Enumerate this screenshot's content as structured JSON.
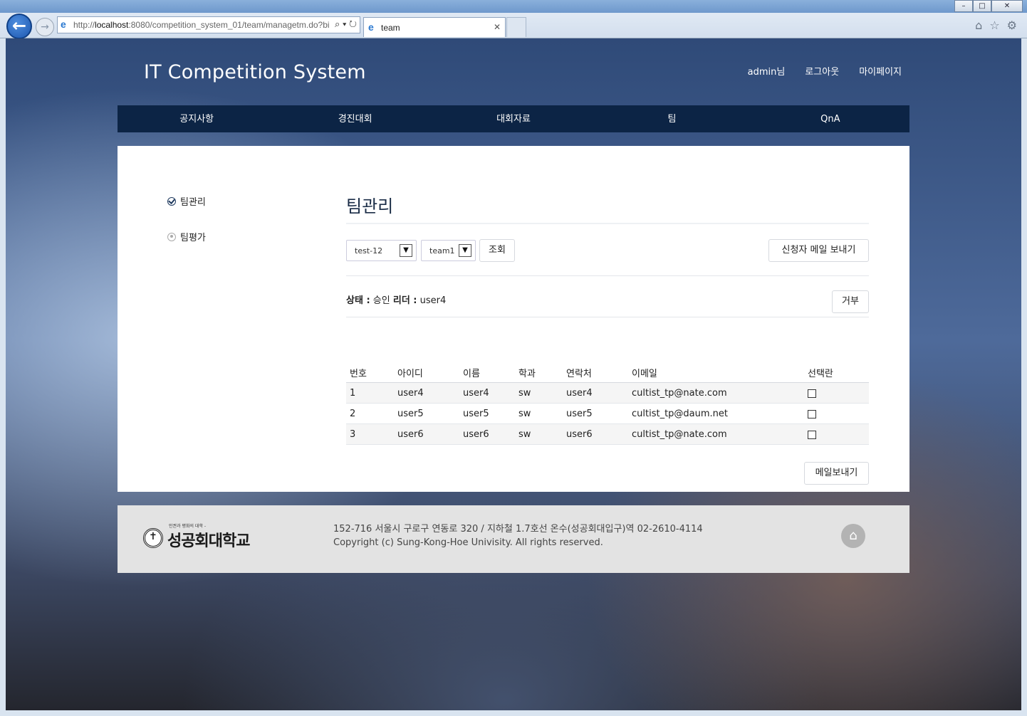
{
  "browser": {
    "url_prefix": "http://",
    "url_host": "localhost",
    "url_rest": ":8080/competition_system_01/team/managetm.do?bi",
    "tab_title": "team",
    "window_buttons": [
      "–",
      "□",
      "✕"
    ]
  },
  "site": {
    "title": "IT Competition System",
    "top_links": {
      "user": "admin님",
      "logout": "로그아웃",
      "mypage": "마이페이지"
    },
    "menu": [
      "공지사항",
      "경진대회",
      "대회자료",
      "팀",
      "QnA"
    ]
  },
  "sidebar": {
    "items": [
      {
        "label": "팀관리",
        "icon": "check-circle-icon"
      },
      {
        "label": "팀평가",
        "icon": "radio-icon"
      }
    ]
  },
  "main": {
    "title": "팀관리",
    "competition_select": "test-12",
    "team_select": "team1",
    "search_button": "조회",
    "mail_applicants_button": "신청자 메일 보내기",
    "status_label": "상태 :",
    "status_value": "승인",
    "leader_label": "리더 :",
    "leader_value": "user4",
    "reject_button": "거부",
    "table": {
      "headers": [
        "번호",
        "아이디",
        "이름",
        "학과",
        "연락처",
        "이메일",
        "선택란"
      ],
      "rows": [
        [
          "1",
          "user4",
          "user4",
          "sw",
          "user4",
          "cultist_tp@nate.com"
        ],
        [
          "2",
          "user5",
          "user5",
          "sw",
          "user5",
          "cultist_tp@daum.net"
        ],
        [
          "3",
          "user6",
          "user6",
          "sw",
          "user6",
          "cultist_tp@nate.com"
        ]
      ]
    },
    "send_mail_button": "메일보내기"
  },
  "footer": {
    "logo_small": "인권과 평화의 대학 -",
    "logo_text": "성공회대학교",
    "address": "152-716 서울시 구로구 연동로 320 / 지하철 1.7호선 온수(성공회대입구)역 02-2610-4114",
    "copyright": "Copyright (c) Sung-Kong-Hoe Univisity. All rights reserved."
  },
  "colors": {
    "nav_bar": "#0c2445",
    "title_text": "#1b2d47",
    "footer_bg": "#e3e3e3"
  }
}
